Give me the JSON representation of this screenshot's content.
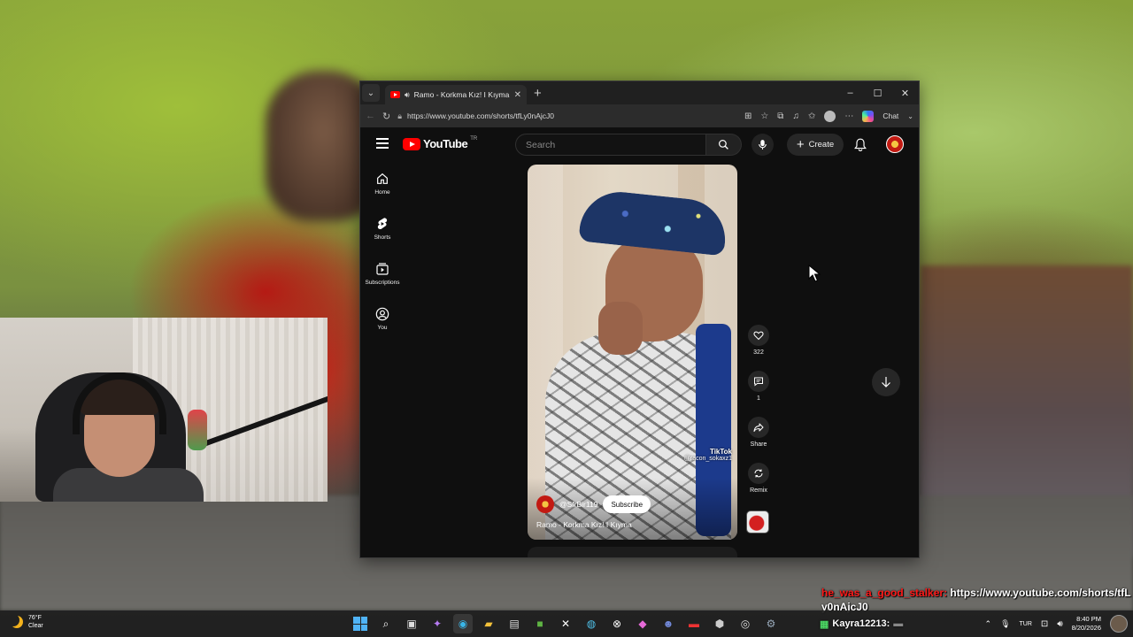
{
  "browser": {
    "tab_title": "Ramo - Korkma Kız! I Kıyma",
    "tab_close": "✕",
    "new_tab": "+",
    "url": "https://www.youtube.com/shorts/tfLy0nAjcJ0",
    "chat_label": "Chat",
    "window_controls": {
      "minimize": "–",
      "maximize": "☐",
      "close": "✕"
    }
  },
  "youtube": {
    "logo_text": "YouTube",
    "region": "TR",
    "search_placeholder": "Search",
    "create_label": "Create",
    "nav": [
      {
        "label": "Home",
        "icon": "home-icon"
      },
      {
        "label": "Shorts",
        "icon": "shorts-icon"
      },
      {
        "label": "Subscriptions",
        "icon": "subscriptions-icon"
      },
      {
        "label": "You",
        "icon": "you-icon"
      }
    ],
    "short": {
      "channel_handle": "@SfrBir119",
      "subscribe_label": "Subscribe",
      "title": "Ramo - Korkma Kız! I Kıyma",
      "watermark_brand": "TikTok",
      "watermark_handle": "@racon_sokaxz1"
    },
    "actions": [
      {
        "icon": "like-icon",
        "label": "322"
      },
      {
        "icon": "comment-icon",
        "label": "1"
      },
      {
        "icon": "share-icon",
        "label": "Share"
      },
      {
        "icon": "remix-icon",
        "label": "Remix"
      }
    ]
  },
  "chat": {
    "username": "he_was_a_good_stalker:",
    "message": " https://www.youtube.com/shorts/tfLy0nAjcJ0"
  },
  "taskbar": {
    "temperature": "76°F",
    "condition": "Clear",
    "chat_user": "Kayra12213:",
    "language": "TUR",
    "time": "8:40 PM",
    "date": "8/20/2026"
  },
  "colors": {
    "youtube_red": "#ff0000",
    "chat_username": "#ff1a1a",
    "accent_blue": "#4fb3f6"
  }
}
